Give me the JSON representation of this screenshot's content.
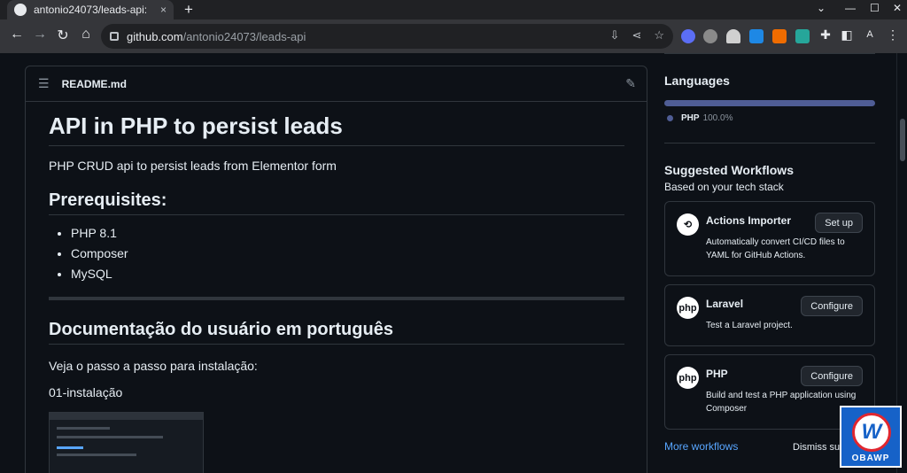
{
  "browser": {
    "tab_title": "antonio24073/leads-api:",
    "tab_close": "×",
    "new_tab": "+",
    "url_host": "github.com",
    "url_path": "/antonio24073/leads-api",
    "profile_letter": "A"
  },
  "readme": {
    "filename": "README.md",
    "h1": "API in PHP to persist leads",
    "intro": "PHP CRUD api to persist leads from Elementor form",
    "prereq_heading": "Prerequisites:",
    "prereq_items": [
      "PHP 8.1",
      "Composer",
      "MySQL"
    ],
    "doc_heading": "Documentação do usuário em português",
    "doc_intro": "Veja o passo a passo para instalação:",
    "step_label": "01-instalação"
  },
  "sidebar": {
    "languages_heading": "Languages",
    "language_name": "PHP",
    "language_pct": "100.0%",
    "language_color": "#4f5d95",
    "workflows_heading": "Suggested Workflows",
    "workflows_sub": "Based on your tech stack",
    "cards": [
      {
        "name": "Actions Importer",
        "desc": "Automatically convert CI/CD files to YAML for GitHub Actions.",
        "button": "Set up"
      },
      {
        "name": "Laravel",
        "desc": "Test a Laravel project.",
        "button": "Configure"
      },
      {
        "name": "PHP",
        "desc": "Build and test a PHP application using Composer",
        "button": "Configure"
      }
    ],
    "more_workflows": "More workflows",
    "dismiss": "Dismiss sug"
  },
  "watermark": {
    "letter": "W",
    "text": "OBAWP"
  }
}
